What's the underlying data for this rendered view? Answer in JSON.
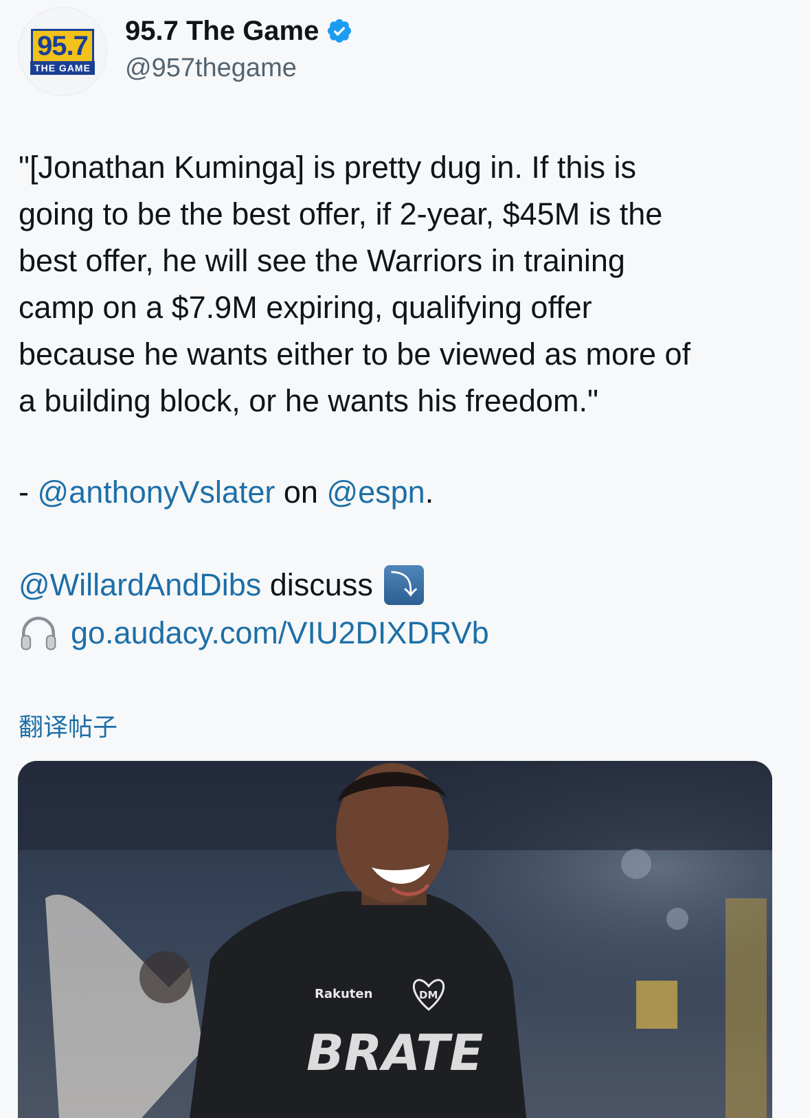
{
  "account": {
    "display_name": "95.7 The Game",
    "handle": "@957thegame",
    "logo_number": "95.7",
    "logo_subtitle": "THE GAME",
    "verified": true,
    "avatar_icon": "station-logo-icon"
  },
  "post": {
    "quote_lines": [
      "\"[Jonathan Kuminga] is pretty dug in. If this is",
      "going to be the best offer, if 2-year, $45M is the",
      "best offer, he will see the Warriors in training",
      "camp on a $7.9M expiring, qualifying offer",
      "because he wants either to be viewed as more of",
      "a building block, or he wants his freedom.\""
    ],
    "attribution_prefix": "- ",
    "attribution_mention_1": "@anthonyVslater",
    "attribution_middle": " on ",
    "attribution_mention_2": "@espn",
    "attribution_suffix": ".",
    "discuss_mention": "@WillardAndDibs",
    "discuss_text": " discuss",
    "discuss_icon": "arrow-down-right-icon",
    "link_icon": "headphones-icon",
    "link_text": "go.audacy.com/VIU2DIXDRVb",
    "translate_label": "翻译帖子"
  },
  "media": {
    "shirt_brand": "Rakuten",
    "shirt_badge": "DM",
    "shirt_text": "BRATE"
  },
  "colors": {
    "link": "#1d6fa8",
    "verified": "#1d9bf0",
    "text": "#0f1419",
    "muted": "#536471"
  }
}
